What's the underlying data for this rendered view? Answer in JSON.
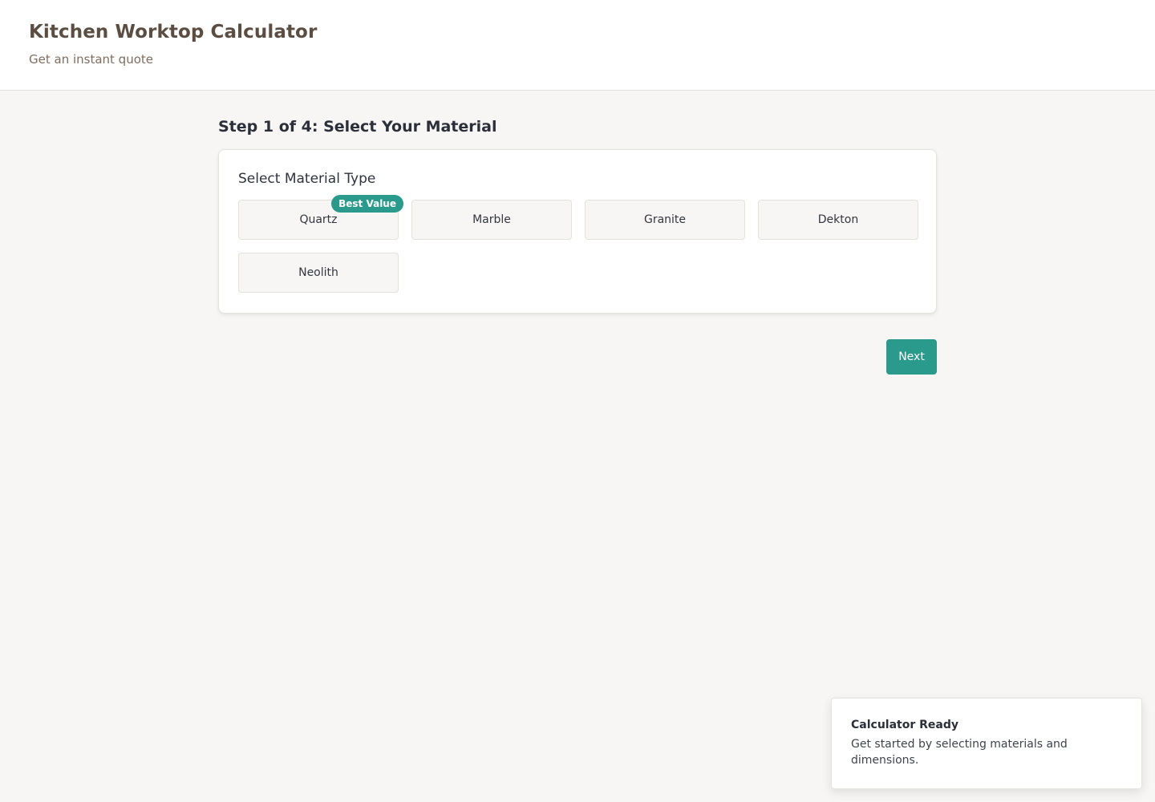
{
  "header": {
    "title": "Kitchen Worktop Calculator",
    "subtitle": "Get an instant quote"
  },
  "step": {
    "title": "Step 1 of 4: Select Your Material"
  },
  "material_card": {
    "title": "Select Material Type",
    "options": [
      {
        "label": "Quartz",
        "badge": "Best Value"
      },
      {
        "label": "Marble"
      },
      {
        "label": "Granite"
      },
      {
        "label": "Dekton"
      },
      {
        "label": "Neolith"
      }
    ]
  },
  "actions": {
    "next_label": "Next"
  },
  "toast": {
    "title": "Calculator Ready",
    "message": "Get started by selecting materials and dimensions."
  },
  "colors": {
    "accent": "#2a9a8c",
    "header_text": "#5b4d42",
    "page_background": "#f7f6f4"
  }
}
